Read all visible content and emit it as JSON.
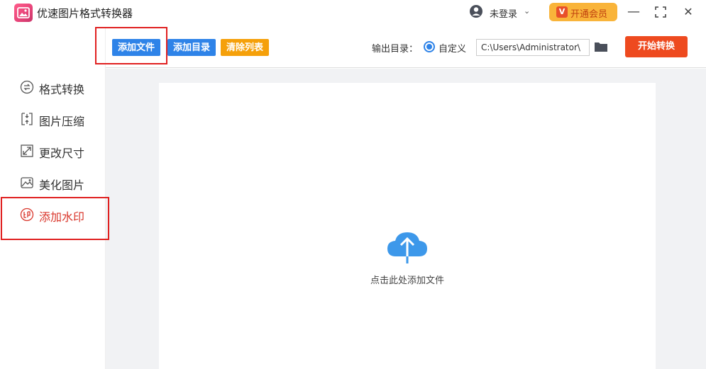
{
  "app": {
    "title": "优速图片格式转换器"
  },
  "header": {
    "login_text": "未登录",
    "login_caret": "⌄",
    "vip_icon": "V",
    "vip_label": "开通会员",
    "minimize": "—",
    "maximize": "⛶",
    "close": "✕"
  },
  "sidebar": {
    "items": [
      {
        "label": "格式转换",
        "icon": "format-convert-icon"
      },
      {
        "label": "图片压缩",
        "icon": "compress-icon"
      },
      {
        "label": "更改尺寸",
        "icon": "resize-icon"
      },
      {
        "label": "美化图片",
        "icon": "beautify-icon"
      },
      {
        "label": "添加水印",
        "icon": "watermark-icon",
        "active": true
      }
    ]
  },
  "toolbar": {
    "add_file": "添加文件",
    "add_folder": "添加目录",
    "clear_list": "清除列表",
    "output_label": "输出目录：",
    "radio_custom": "自定义",
    "output_path": "C:\\Users\\Administrator\\",
    "start_button": "开始转换"
  },
  "main": {
    "drop_text": "点击此处添加文件"
  },
  "colors": {
    "accent_blue": "#2e83e8",
    "accent_orange": "#f5a00a",
    "start_red": "#ee4a1f",
    "active_red": "#d9362b",
    "highlight_box": "#e02020"
  }
}
